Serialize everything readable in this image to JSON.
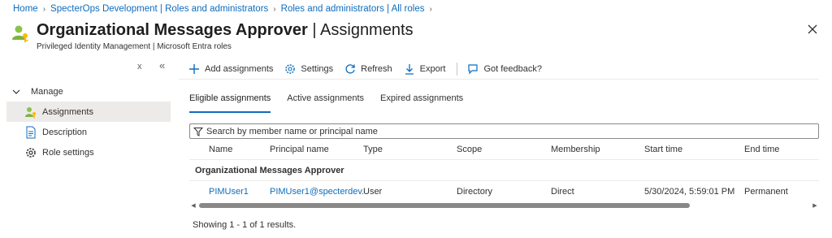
{
  "breadcrumb": [
    "Home",
    "SpecterOps Development | Roles and administrators",
    "Roles and administrators | All roles"
  ],
  "header": {
    "title_main": "Organizational Messages Approver",
    "title_sep": " | ",
    "title_section": "Assignments",
    "subtitle": "Privileged Identity Management | Microsoft Entra roles",
    "more": "···"
  },
  "sidebar": {
    "collapse_glyph": "x",
    "collapse_all_glyph": "«",
    "group_label": "Manage",
    "items": [
      {
        "label": "Assignments",
        "icon": "user-key-icon",
        "active": true
      },
      {
        "label": "Description",
        "icon": "document-icon",
        "active": false
      },
      {
        "label": "Role settings",
        "icon": "gear-icon",
        "active": false
      }
    ]
  },
  "toolbar": {
    "add": "Add assignments",
    "settings": "Settings",
    "refresh": "Refresh",
    "export": "Export",
    "feedback": "Got feedback?"
  },
  "tabs": [
    {
      "label": "Eligible assignments",
      "active": true
    },
    {
      "label": "Active assignments",
      "active": false
    },
    {
      "label": "Expired assignments",
      "active": false
    }
  ],
  "search": {
    "placeholder": "Search by member name or principal name"
  },
  "table": {
    "columns": [
      "Name",
      "Principal name",
      "Type",
      "Scope",
      "Membership",
      "Start time",
      "End time"
    ],
    "group": "Organizational Messages Approver",
    "rows": [
      {
        "name": "PIMUser1",
        "principal": "PIMUser1@specterdev.",
        "type": "User",
        "scope": "Directory",
        "membership": "Direct",
        "start": "5/30/2024, 5:59:01 PM",
        "end": "Permanent"
      }
    ]
  },
  "results": "Showing 1 - 1 of 1 results.",
  "colors": {
    "link": "#0f6cbd",
    "active_tab_underline": "#0f6cbd",
    "selected_nav_bg": "#edebe9"
  }
}
